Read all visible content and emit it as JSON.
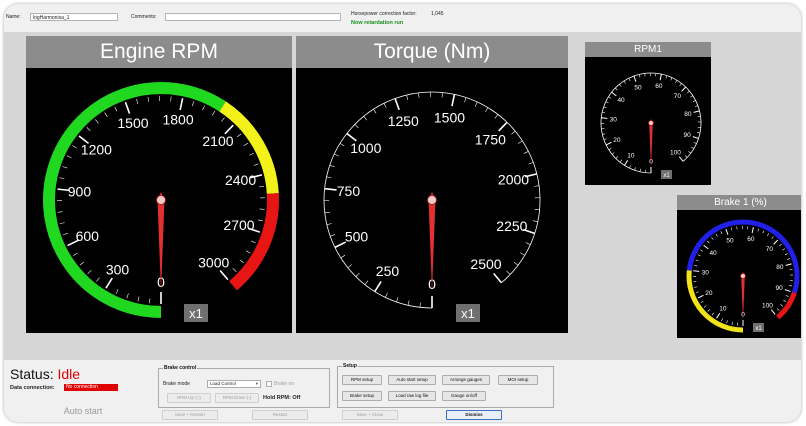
{
  "topbar": {
    "name_label": "Name:",
    "name_value": "logHarmonisa_1",
    "comments_label": "Comments:",
    "comments_value": "",
    "hp_label": "Horsepower correction factor:",
    "hp_value": "1,045",
    "status_message": "Now retardation run"
  },
  "gauges": {
    "rpm": {
      "title": "Engine RPM",
      "ticks": [
        "0",
        "300",
        "600",
        "900",
        "1200",
        "1500",
        "1800",
        "2100",
        "2400",
        "2700",
        "3000"
      ],
      "multiplier": "x1",
      "value": 0,
      "bands": [
        {
          "from": 0,
          "to": 2000,
          "color": "#1fd81f"
        },
        {
          "from": 2000,
          "to": 2500,
          "color": "#f2f21a"
        },
        {
          "from": 2500,
          "to": 3000,
          "color": "#e81515"
        }
      ]
    },
    "torque": {
      "title": "Torque (Nm)",
      "ticks": [
        "0",
        "250",
        "500",
        "750",
        "1000",
        "1250",
        "1500",
        "1750",
        "2000",
        "2250",
        "2500"
      ],
      "multiplier": "x1",
      "value": 0
    },
    "rpm1": {
      "title": "RPM1",
      "ticks": [
        "0",
        "10",
        "20",
        "30",
        "40",
        "50",
        "60",
        "70",
        "80",
        "90",
        "100"
      ],
      "multiplier": "x1",
      "value": 0
    },
    "brake1": {
      "title": "Brake 1 (%)",
      "ticks": [
        "0",
        "10",
        "20",
        "30",
        "40",
        "50",
        "60",
        "70",
        "80",
        "90",
        "100"
      ],
      "multiplier": "x1",
      "value": 0,
      "bands": [
        {
          "from": 0,
          "to": 30,
          "color": "#f2e21a"
        },
        {
          "from": 30,
          "to": 90,
          "color": "#2020e8"
        },
        {
          "from": 90,
          "to": 100,
          "color": "#e81515"
        }
      ]
    }
  },
  "status": {
    "label": "Status:",
    "value": "Idle",
    "connection_label": "Data connection:",
    "connection_value": "No connection",
    "autostart_label": "Auto start"
  },
  "brake_control": {
    "title": "Brake control",
    "mode_label": "Brake mode",
    "mode_value": "Load Control",
    "brake_on_label": "Brake on",
    "rpm_up_label": "RPM Up (+)",
    "rpm_down_label": "RPM Down (-)",
    "hold_rpm_label": "Hold RPM: Off"
  },
  "setup": {
    "title": "Setup",
    "buttons": [
      "RPM setup",
      "Auto start setup",
      "Arrange gauges",
      "MOI setup",
      "Brake setup",
      "Load raw log file",
      "Gauge on/off"
    ]
  },
  "footer": {
    "save_restart": "Save + Restart",
    "restart": "Restart",
    "save_close": "Save + Close",
    "dismiss": "Dismiss"
  },
  "colors": {
    "gauge_bg": "#000000",
    "needle": "#e03030",
    "title_bar": "#8c8c8c",
    "status_red": "#e00000"
  }
}
